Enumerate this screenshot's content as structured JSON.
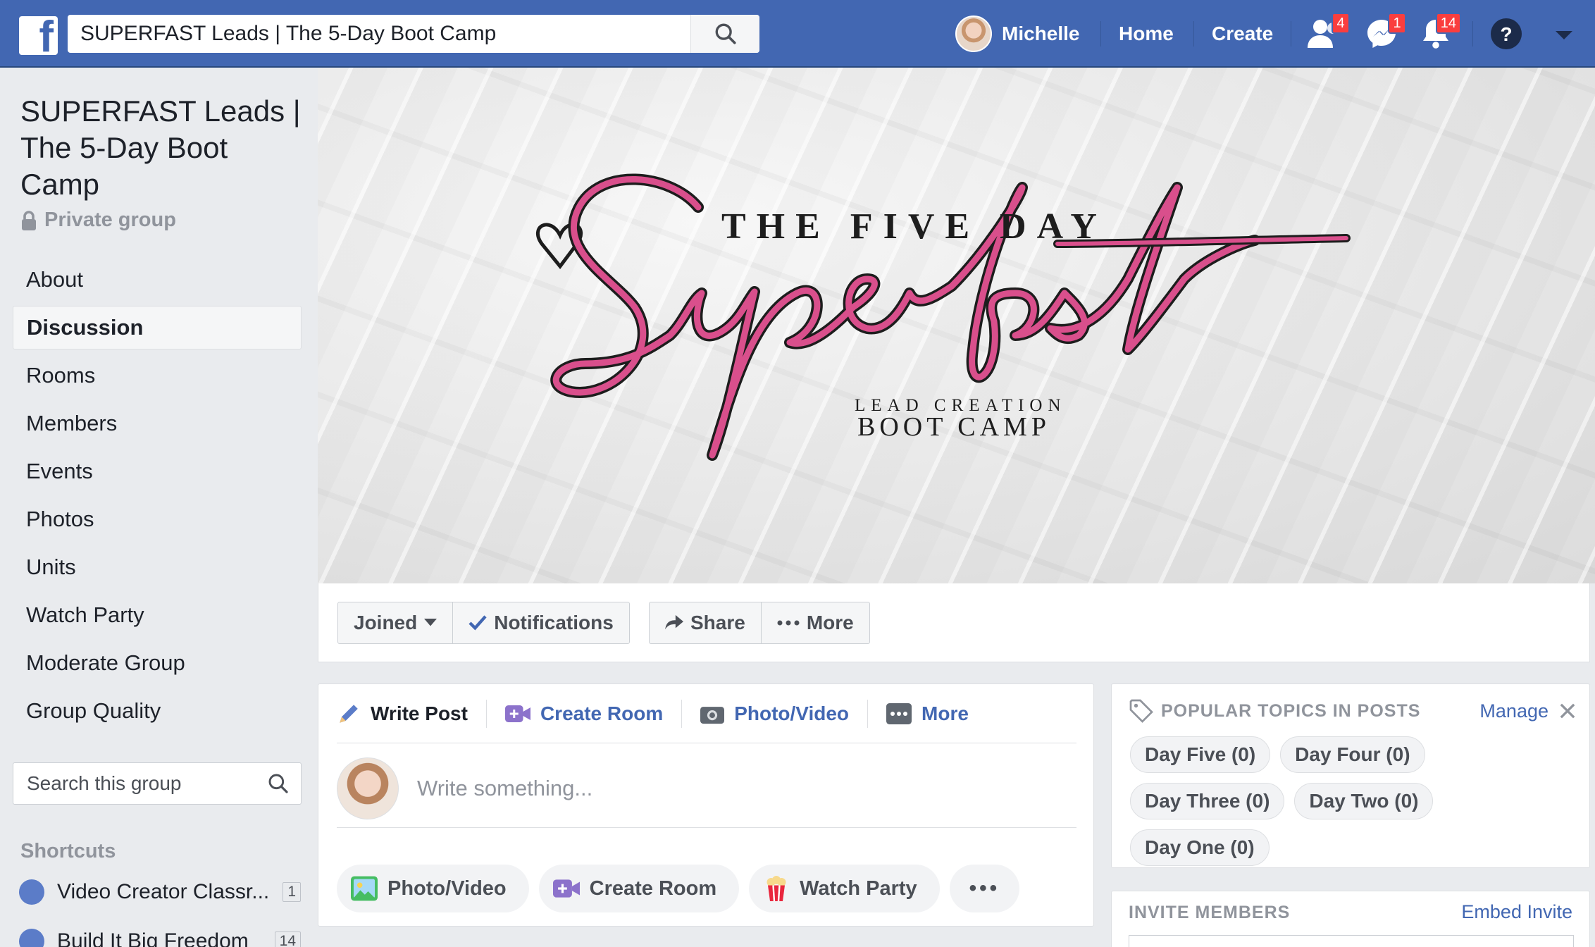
{
  "topbar": {
    "logo": "f",
    "search_value": "SUPERFAST Leads | The 5-Day Boot Camp",
    "user_name": "Michelle",
    "home_label": "Home",
    "create_label": "Create",
    "friend_requests_count": "4",
    "messages_count": "1",
    "notifications_count": "14",
    "icons": [
      "search-icon",
      "friends-icon",
      "messenger-icon",
      "bell-icon",
      "help-icon",
      "caret-down-icon"
    ]
  },
  "sidebar": {
    "group_title": "SUPERFAST Leads | The 5-Day Boot Camp",
    "privacy": "Private group",
    "items": [
      {
        "label": "About"
      },
      {
        "label": "Discussion",
        "active": true
      },
      {
        "label": "Rooms"
      },
      {
        "label": "Members"
      },
      {
        "label": "Events"
      },
      {
        "label": "Photos"
      },
      {
        "label": "Units"
      },
      {
        "label": "Watch Party"
      },
      {
        "label": "Moderate Group"
      },
      {
        "label": "Group Quality"
      }
    ],
    "search_placeholder": "Search this group",
    "shortcuts_label": "Shortcuts",
    "shortcuts": [
      {
        "name": "Video Creator Classr...",
        "count": "1"
      },
      {
        "name": "Build It Big Freedom",
        "count": "14"
      }
    ]
  },
  "cover": {
    "top_text": "THE FIVE DAY",
    "script_text": "Superfast",
    "sub_text_1": "LEAD CREATION",
    "sub_text_2": "BOOT CAMP",
    "accent_color": "#d94f8c"
  },
  "actions": {
    "joined": "Joined",
    "notifications": "Notifications",
    "share": "Share",
    "more": "More"
  },
  "composer": {
    "tabs": [
      "Write Post",
      "Create Room",
      "Photo/Video",
      "More"
    ],
    "placeholder": "Write something...",
    "buttons": [
      "Photo/Video",
      "Create Room",
      "Watch Party",
      "•••"
    ]
  },
  "topics": {
    "title": "POPULAR TOPICS IN POSTS",
    "manage": "Manage",
    "chips": [
      "Day Five (0)",
      "Day Four (0)",
      "Day Three (0)",
      "Day Two (0)",
      "Day One (0)"
    ]
  },
  "invite": {
    "title": "INVITE MEMBERS",
    "link": "Embed Invite"
  },
  "colors": {
    "brand": "#4267b2",
    "badge": "#fa3e3e",
    "link": "#4267b2"
  }
}
